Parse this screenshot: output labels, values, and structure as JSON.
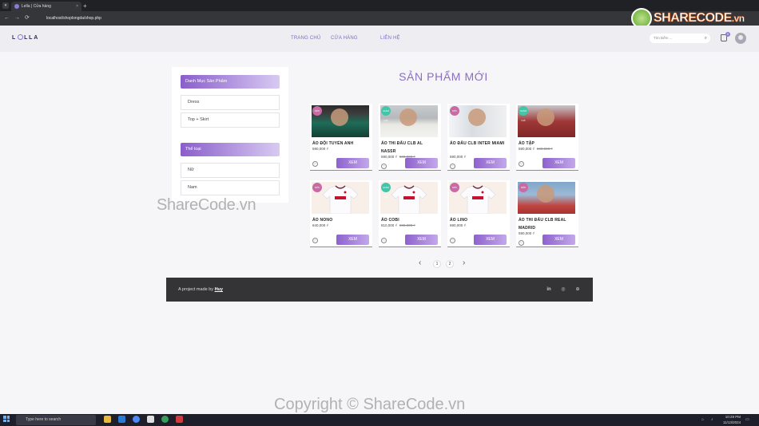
{
  "browser": {
    "tab_title": "Lella | Cửa hàng",
    "new_tab": "+",
    "url": "localhost/shoplongda/shop.php",
    "nav": {
      "back": "←",
      "forward": "→",
      "reload": "⟳"
    }
  },
  "header": {
    "logo": {
      "part1": "L",
      "part2": "LLA"
    },
    "nav": [
      "TRANG CHỦ",
      "CỬA HÀNG",
      "LIÊN HỆ"
    ],
    "search_placeholder": "Tìm kiếm ...",
    "cart_count": "0"
  },
  "sidebar": {
    "categories_title": "Danh Mục Sản Phẩm",
    "categories": [
      "Dress",
      "Top + Skirt"
    ],
    "types_title": "Thể loại",
    "types": [
      "Nữ",
      "Nam"
    ]
  },
  "main": {
    "title": "SẢN PHẨM MỚI",
    "view_label": "XEM",
    "products": [
      {
        "name": "ÁO ĐỘI TUYỂN ANH",
        "price": "590,000 ₫",
        "old_price": "",
        "badge": "MỚI",
        "badge_color": "#c86aa4",
        "img": "player-green"
      },
      {
        "name": "ÁO THI ĐẤU CLB AL NASSR",
        "price": "590,000 ₫",
        "old_price": "500,000 ₫",
        "badge": "GIẢM GIÁ",
        "badge_color": "#44c4a8",
        "img": "player-white"
      },
      {
        "name": "ÁO ĐẤU CLB INTER MIAMI",
        "price": "590,000 ₫",
        "old_price": "",
        "badge": "MỚI",
        "badge_color": "#c86aa4",
        "img": "player-office"
      },
      {
        "name": "ÁO TẬP",
        "price": "590,000 ₫",
        "old_price": "500,000 ₫",
        "badge": "GIẢM GIÁ",
        "badge_color": "#44c4a8",
        "img": "player-red"
      },
      {
        "name": "ÁO NONO",
        "price": "840,000 ₫",
        "old_price": "",
        "badge": "MỚI",
        "badge_color": "#c86aa4",
        "img": "jersey"
      },
      {
        "name": "ÁO COBI",
        "price": "810,000 ₫",
        "old_price": "900,000 ₫",
        "badge": "GIẢM GIÁ",
        "badge_color": "#44c4a8",
        "img": "jersey"
      },
      {
        "name": "ÁO LINO",
        "price": "690,000 ₫",
        "old_price": "",
        "badge": "MỚI",
        "badge_color": "#c86aa4",
        "img": "jersey"
      },
      {
        "name": "ÁO THI ĐẤU CLB REAL MADRID",
        "price": "590,000 ₫",
        "old_price": "",
        "badge": "MỚI",
        "badge_color": "#c86aa4",
        "img": "player-sky"
      }
    ],
    "pagination": {
      "prev": "‹",
      "pages": [
        "1",
        "2"
      ],
      "next": "›"
    }
  },
  "footer": {
    "text": "A project made by ",
    "author": "Huy",
    "icons": [
      "linkedin-icon",
      "dribbble-icon",
      "globe-icon"
    ]
  },
  "watermarks": {
    "center": "ShareCode.vn",
    "bottom": "Copyright © ShareCode.vn",
    "logo_main": "SHARECODE",
    "logo_suffix": ".vn"
  },
  "taskbar": {
    "search_placeholder": "Type here to search",
    "time": "10:29 PM",
    "date": "11/13/2024"
  }
}
